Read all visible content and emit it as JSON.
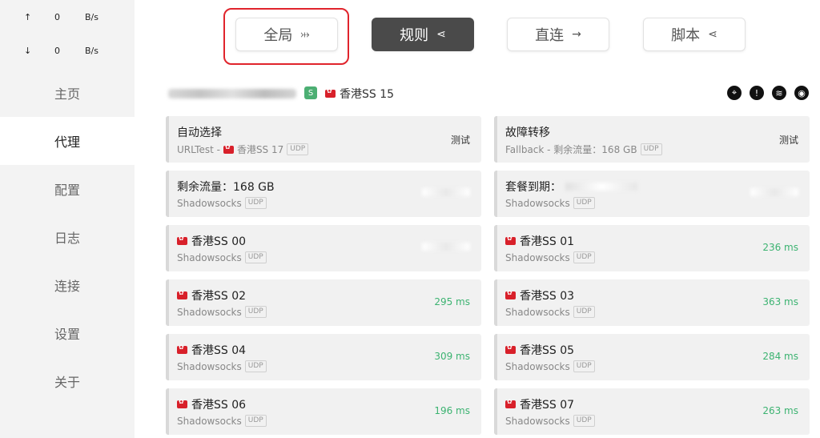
{
  "traffic": {
    "up": {
      "arrow": "↑",
      "value": "0",
      "unit": "B/s"
    },
    "down": {
      "arrow": "↓",
      "value": "0",
      "unit": "B/s"
    }
  },
  "sidebar": {
    "items": [
      {
        "label": "主页"
      },
      {
        "label": "代理"
      },
      {
        "label": "配置"
      },
      {
        "label": "日志"
      },
      {
        "label": "连接"
      },
      {
        "label": "设置"
      },
      {
        "label": "关于"
      }
    ]
  },
  "modes": {
    "global": {
      "label": "全局",
      "icon": "⤔"
    },
    "rule": {
      "label": "规则",
      "icon": "⋖"
    },
    "direct": {
      "label": "直连",
      "icon": "→"
    },
    "script": {
      "label": "脚本",
      "icon": "⋖"
    }
  },
  "group": {
    "badge": "S",
    "current_node": "香港SS 15"
  },
  "colors": {
    "delay_green": "#3cb371",
    "active_mode": "#4a4a4a",
    "highlight": "#e0242c"
  },
  "cards": {
    "c0": {
      "title": "自动选择",
      "sub_type": "URLTest -",
      "sub_node": "香港SS 17",
      "udp": "UDP",
      "action": "测试"
    },
    "c1": {
      "title": "故障转移",
      "sub_type": "Fallback - 剩余流量：168 GB",
      "udp": "UDP",
      "action": "测试"
    },
    "c2": {
      "title": "剩余流量：168 GB",
      "sub": "Shadowsocks",
      "udp": "UDP"
    },
    "c3": {
      "title": "套餐到期：",
      "sub": "Shadowsocks",
      "udp": "UDP"
    },
    "c4": {
      "title": "香港SS 00",
      "sub": "Shadowsocks",
      "udp": "UDP"
    },
    "c5": {
      "title": "香港SS 01",
      "sub": "Shadowsocks",
      "udp": "UDP",
      "delay": "236 ms"
    },
    "c6": {
      "title": "香港SS 02",
      "sub": "Shadowsocks",
      "udp": "UDP",
      "delay": "295 ms"
    },
    "c7": {
      "title": "香港SS 03",
      "sub": "Shadowsocks",
      "udp": "UDP",
      "delay": "363 ms"
    },
    "c8": {
      "title": "香港SS 04",
      "sub": "Shadowsocks",
      "udp": "UDP",
      "delay": "309 ms"
    },
    "c9": {
      "title": "香港SS 05",
      "sub": "Shadowsocks",
      "udp": "UDP",
      "delay": "284 ms"
    },
    "c10": {
      "title": "香港SS 06",
      "sub": "Shadowsocks",
      "udp": "UDP",
      "delay": "196 ms"
    },
    "c11": {
      "title": "香港SS 07",
      "sub": "Shadowsocks",
      "udp": "UDP",
      "delay": "263 ms"
    }
  }
}
